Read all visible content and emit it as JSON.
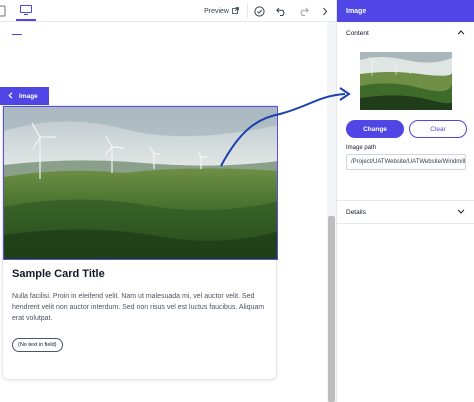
{
  "toolbar": {
    "preview_label": "Preview",
    "device_icon": "desktop-icon",
    "icons": [
      "external-link-icon",
      "check-circle-icon",
      "undo-icon",
      "redo-icon",
      "chevron-right-icon"
    ]
  },
  "canvas": {
    "tag_label": "Image",
    "card": {
      "title": "Sample Card Title",
      "text": "Nulla facilisi. Proin in eleifend velit. Nam ut malesuada mi, vel auctor velit. Sed hendrerit velit non auctor interdum. Sed non risus vel est luctus faucibus. Aliquam erat volutpat.",
      "chip": "(No text in field)"
    }
  },
  "panel": {
    "title": "Image",
    "content_section": "Content",
    "change_label": "Change",
    "clear_label": "Clear",
    "path_label": "Image path",
    "path_value": "/Project/UATWebsite/UATWebsite/Windmills",
    "details_section": "Details"
  },
  "colors": {
    "accent": "#4f46e5",
    "arrow": "#1e40af"
  }
}
